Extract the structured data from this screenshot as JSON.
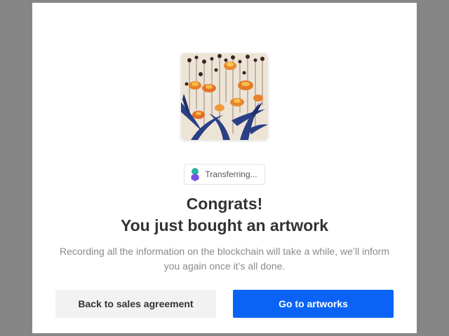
{
  "modal": {
    "status": {
      "label": "Transferring...",
      "icon": "blockchain-transfer-icon"
    },
    "title_line1": "Congrats!",
    "title_line2": "You just bought an artwork",
    "message": "Recording all the information on the blockchain will take a while, we’ll inform you again once it’s all done.",
    "buttons": {
      "secondary_label": "Back to sales agreement",
      "primary_label": "Go to artworks"
    }
  },
  "colors": {
    "primary": "#0a63f5",
    "overlay": "#868686",
    "chain_icon_top": "#2bb3a0",
    "chain_icon_bottom": "#7b4fe0"
  }
}
